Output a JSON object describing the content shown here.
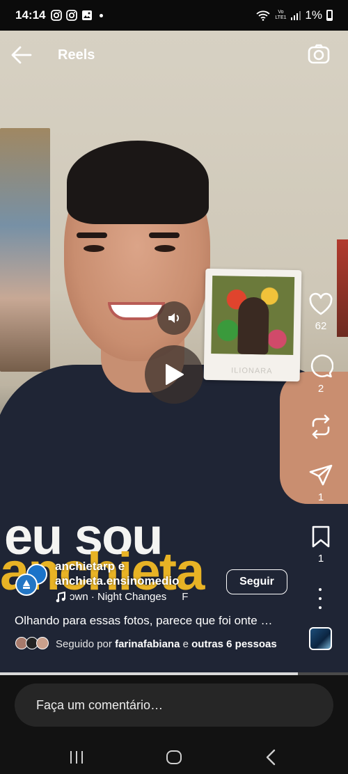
{
  "status_bar": {
    "time": "14:14",
    "battery": "1%",
    "network": "Vo LTE1"
  },
  "header": {
    "title": "Reels"
  },
  "actions": {
    "likes": "62",
    "comments": "2",
    "shares": "1",
    "saves": "1"
  },
  "post": {
    "author_line1": "anchietarp e",
    "author_line2": "anchieta.ensinomedio",
    "follow_label": "Seguir",
    "music": "ɔwn · Night Changes",
    "music_extra": "F",
    "caption": "Olhando para essas fotos, parece que foi onte …",
    "followed_prefix": "Seguido por",
    "followed_user": "farinafabiana",
    "followed_middle": "e",
    "followed_others": "outras 6 pessoas"
  },
  "video_text": {
    "line1": "eu sou",
    "line2": "anchieta",
    "polaroid": "ILIONARA"
  },
  "progress": 0.856,
  "comment": {
    "placeholder": "Faça um comentário…"
  },
  "colors": {
    "accent_yellow": "#e8b325",
    "school_blue": "#1a73c9"
  }
}
